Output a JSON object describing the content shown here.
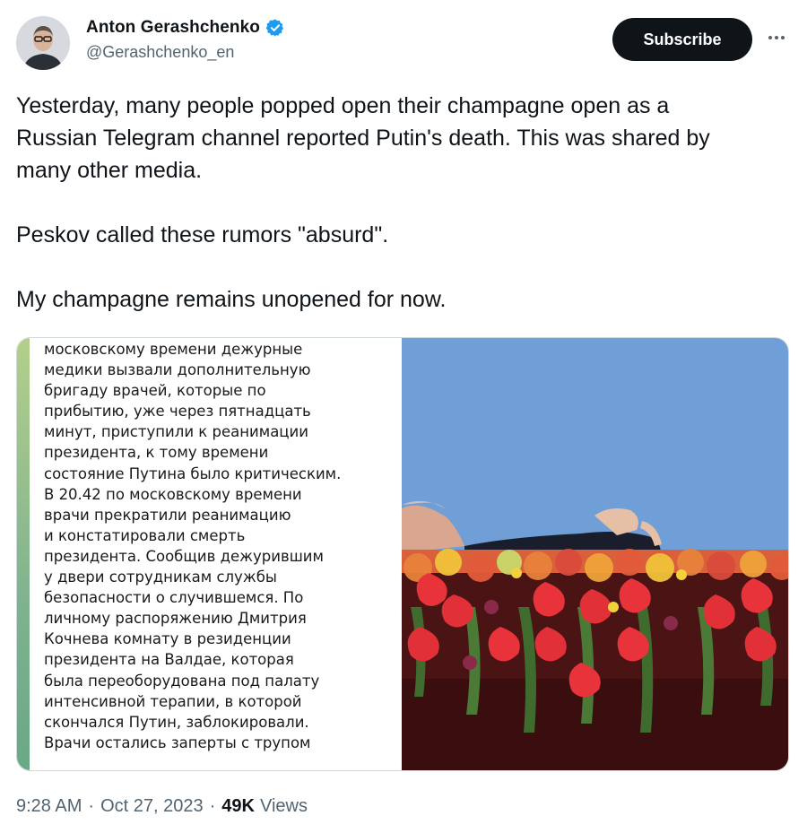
{
  "author": {
    "display_name": "Anton Gerashchenko",
    "handle": "@Gerashchenko_en",
    "verified": true,
    "verified_color": "#1d9bf0"
  },
  "actions": {
    "subscribe_label": "Subscribe",
    "more_icon": "ellipsis-icon"
  },
  "tweet": {
    "paragraphs": [
      "Yesterday, many people popped open their champagne open as a",
      "Russian Telegram channel reported Putin's death. This was shared by",
      "many other media.",
      "Peskov called these rumors \"absurd\".",
      "My champagne remains unopened for now."
    ]
  },
  "media": {
    "screenshot_text": [
      "московскому времени дежурные",
      "медики вызвали дополнительную",
      "бригаду врачей, которые по",
      "прибытию, уже через пятнадцать",
      "минут, приступили к реанимации",
      "президента, к тому времени",
      "состояние Путина было критическим.",
      "В 20.42 по московскому времени",
      "врачи прекратили реанимацию",
      "и констатировали смерть",
      "президента. Сообщив дежурившим",
      "у двери сотрудникам службы",
      "безопасности о случившемся. По",
      "личному распоряжению Дмитрия",
      "Кочнева комнату в резиденции",
      "президента на Валдае, которая",
      "была переоборудована под палату",
      "интенсивной терапии, в которой",
      "скончался Путин, заблокировали.",
      "Врачи остались заперты с трупом"
    ],
    "accent_bar_color": "#7fb38f",
    "photo_sky_color": "#6f9fd6"
  },
  "meta": {
    "time": "9:28 AM",
    "separator": "·",
    "date": "Oct 27, 2023",
    "views_count": "49K",
    "views_label": "Views"
  }
}
